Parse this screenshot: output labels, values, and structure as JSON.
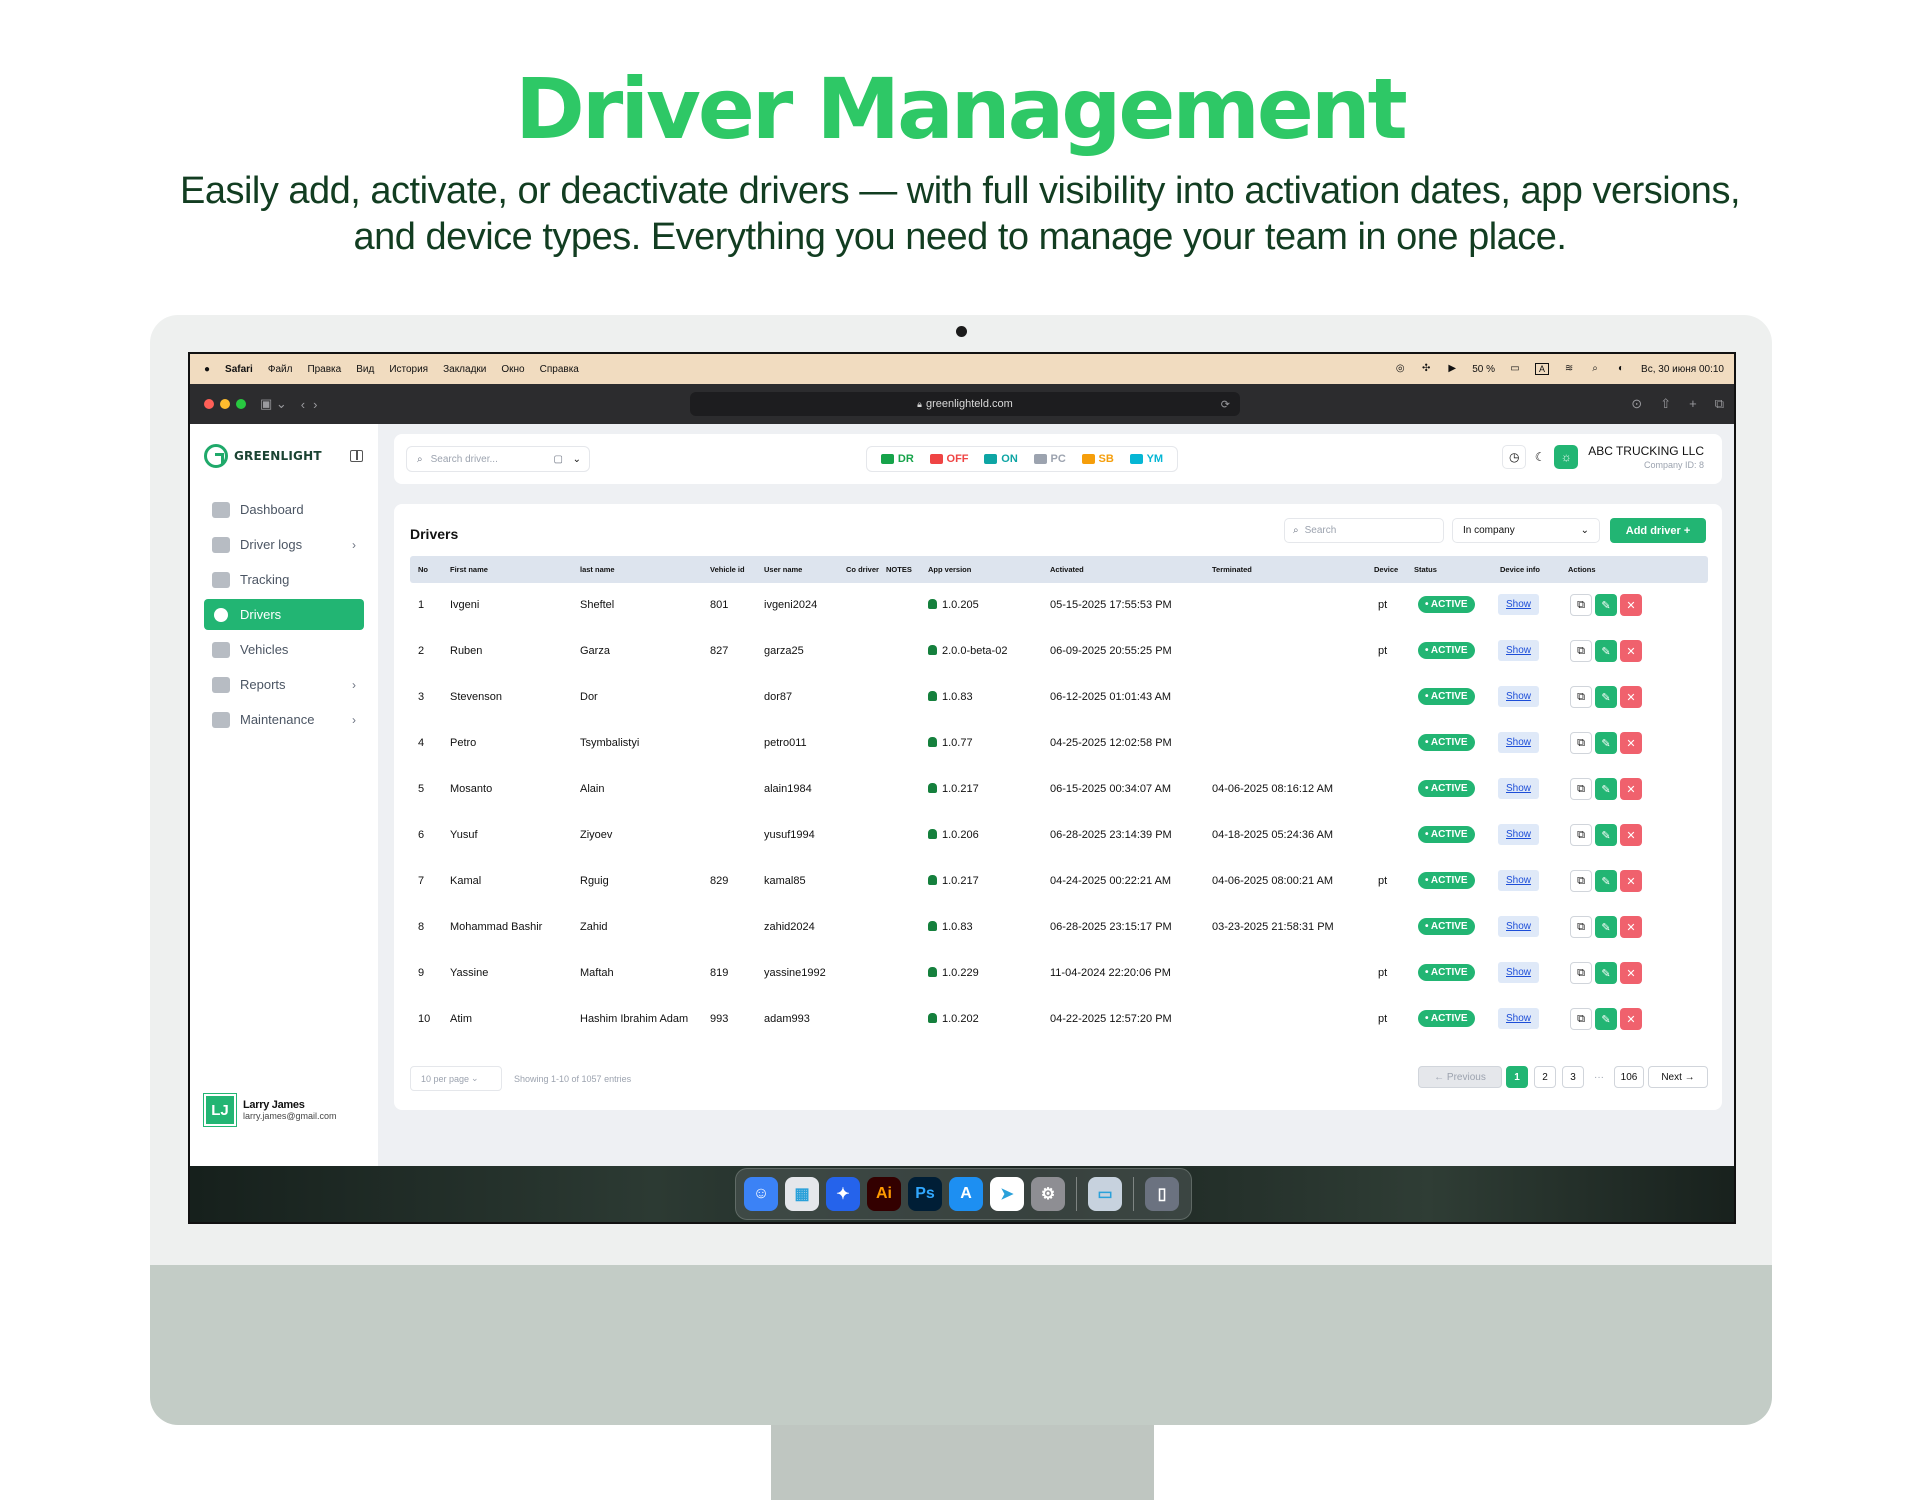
{
  "hero": {
    "title": "Driver Management",
    "subtitle": "Easily add, activate, or deactivate drivers — with full visibility into activation dates, app versions, and device types. Everything you need to manage your team in one place."
  },
  "menubar": {
    "items": [
      "Safari",
      "Файл",
      "Правка",
      "Вид",
      "История",
      "Закладки",
      "Окно",
      "Справка"
    ],
    "battery": "50 %",
    "input": "A",
    "datetime": "Вс, 30 июня  00:10"
  },
  "browser": {
    "url": "greenlighteld.com"
  },
  "sidebar": {
    "brand": "GREENLIGHT",
    "items": [
      {
        "label": "Dashboard",
        "icon": "dashboard-icon"
      },
      {
        "label": "Driver logs",
        "icon": "driver-logs-icon"
      },
      {
        "label": "Tracking",
        "icon": "map-icon"
      },
      {
        "label": "Drivers",
        "icon": "driver-icon"
      },
      {
        "label": "Vehicles",
        "icon": "truck-icon"
      },
      {
        "label": "Reports",
        "icon": "reports-icon"
      },
      {
        "label": "Maintenance",
        "icon": "layers-icon"
      }
    ],
    "user": {
      "initials": "LJ",
      "name": "Larry James",
      "email": "larry.james@gmail.com"
    }
  },
  "topbar": {
    "search_placeholder": "Search driver...",
    "statuses": [
      {
        "label": "DR",
        "color": "#16a34a"
      },
      {
        "label": "OFF",
        "color": "#ef4444"
      },
      {
        "label": "ON",
        "color": "#0ea5a4"
      },
      {
        "label": "PC",
        "color": "#9ca3af"
      },
      {
        "label": "SB",
        "color": "#f59e0b"
      },
      {
        "label": "YM",
        "color": "#06b6d4"
      }
    ],
    "company": "ABC TRUCKING LLC",
    "company_id": "Company ID: 8"
  },
  "drivers": {
    "title": "Drivers",
    "search_placeholder": "Search",
    "filter": "In company",
    "add_label": "Add driver +",
    "columns": [
      "No",
      "First name",
      "last name",
      "Vehicle id",
      "User name",
      "Co driver",
      "NOTES",
      "App version",
      "Activated",
      "Terminated",
      "Device",
      "Status",
      "Device info",
      "Actions"
    ],
    "rows": [
      {
        "no": "1",
        "first": "Ivgeni",
        "last": "Sheftel",
        "vehicle": "801",
        "user": "ivgeni2024",
        "version": "1.0.205",
        "activated": "05-15-2025 17:55:53 PM",
        "terminated": "",
        "device": "pt",
        "status": "• ACTIVE",
        "info": "Show"
      },
      {
        "no": "2",
        "first": "Ruben",
        "last": "Garza",
        "vehicle": "827",
        "user": "garza25",
        "version": "2.0.0-beta-02",
        "activated": "06-09-2025 20:55:25 PM",
        "terminated": "",
        "device": "pt",
        "status": "• ACTIVE",
        "info": "Show"
      },
      {
        "no": "3",
        "first": "Stevenson",
        "last": "Dor",
        "vehicle": "",
        "user": "dor87",
        "version": "1.0.83",
        "activated": "06-12-2025 01:01:43 AM",
        "terminated": "",
        "device": "",
        "status": "• ACTIVE",
        "info": "Show"
      },
      {
        "no": "4",
        "first": "Petro",
        "last": "Tsymbalistyi",
        "vehicle": "",
        "user": "petro011",
        "version": "1.0.77",
        "activated": "04-25-2025 12:02:58 PM",
        "terminated": "",
        "device": "",
        "status": "• ACTIVE",
        "info": "Show"
      },
      {
        "no": "5",
        "first": "Mosanto",
        "last": "Alain",
        "vehicle": "",
        "user": "alain1984",
        "version": "1.0.217",
        "activated": "06-15-2025 00:34:07 AM",
        "terminated": "04-06-2025 08:16:12 AM",
        "device": "",
        "status": "• ACTIVE",
        "info": "Show"
      },
      {
        "no": "6",
        "first": "Yusuf",
        "last": "Ziyoev",
        "vehicle": "",
        "user": "yusuf1994",
        "version": "1.0.206",
        "activated": "06-28-2025 23:14:39 PM",
        "terminated": "04-18-2025 05:24:36 AM",
        "device": "",
        "status": "• ACTIVE",
        "info": "Show"
      },
      {
        "no": "7",
        "first": "Kamal",
        "last": "Rguig",
        "vehicle": "829",
        "user": "kamal85",
        "version": "1.0.217",
        "activated": "04-24-2025 00:22:21 AM",
        "terminated": "04-06-2025 08:00:21 AM",
        "device": "pt",
        "status": "• ACTIVE",
        "info": "Show"
      },
      {
        "no": "8",
        "first": "Mohammad Bashir",
        "last": "Zahid",
        "vehicle": "",
        "user": "zahid2024",
        "version": "1.0.83",
        "activated": "06-28-2025 23:15:17 PM",
        "terminated": "03-23-2025 21:58:31 PM",
        "device": "",
        "status": "• ACTIVE",
        "info": "Show"
      },
      {
        "no": "9",
        "first": "Yassine",
        "last": "Maftah",
        "vehicle": "819",
        "user": "yassine1992",
        "version": "1.0.229",
        "activated": "11-04-2024 22:20:06 PM",
        "terminated": "",
        "device": "pt",
        "status": "• ACTIVE",
        "info": "Show"
      },
      {
        "no": "10",
        "first": "Atim",
        "last": "Hashim Ibrahim Adam",
        "vehicle": "993",
        "user": "adam993",
        "version": "1.0.202",
        "activated": "04-22-2025 12:57:20 PM",
        "terminated": "",
        "device": "pt",
        "status": "• ACTIVE",
        "info": "Show"
      }
    ],
    "pagination": {
      "per_page": "10 per page",
      "showing": "Showing 1-10 of 1057 entries",
      "prev": "← Previous",
      "pages": [
        "1",
        "2",
        "3"
      ],
      "dots": "···",
      "last": "106",
      "next": "Next →",
      "current": "1"
    }
  },
  "dock": {
    "apps": [
      {
        "icon": "finder-icon",
        "glyph": "☺",
        "color": "#3b82f6"
      },
      {
        "icon": "launchpad-icon",
        "glyph": "▦",
        "color": "#e5e7eb"
      },
      {
        "icon": "safari-icon",
        "glyph": "✦",
        "color": "#2563eb"
      },
      {
        "icon": "illustrator-icon",
        "glyph": "Ai",
        "color": "#330000"
      },
      {
        "icon": "photoshop-icon",
        "glyph": "Ps",
        "color": "#001e36"
      },
      {
        "icon": "app-store-icon",
        "glyph": "A",
        "color": "#1d8ff2"
      },
      {
        "icon": "telegram-icon",
        "glyph": "➤",
        "color": "#ffffff"
      },
      {
        "icon": "system-settings-icon",
        "glyph": "⚙",
        "color": "#8e8e93"
      },
      {
        "icon": "preview-icon",
        "glyph": "▭",
        "color": "#c7d2de"
      },
      {
        "icon": "trash-icon",
        "glyph": "▯",
        "color": "#6b7280"
      }
    ]
  }
}
